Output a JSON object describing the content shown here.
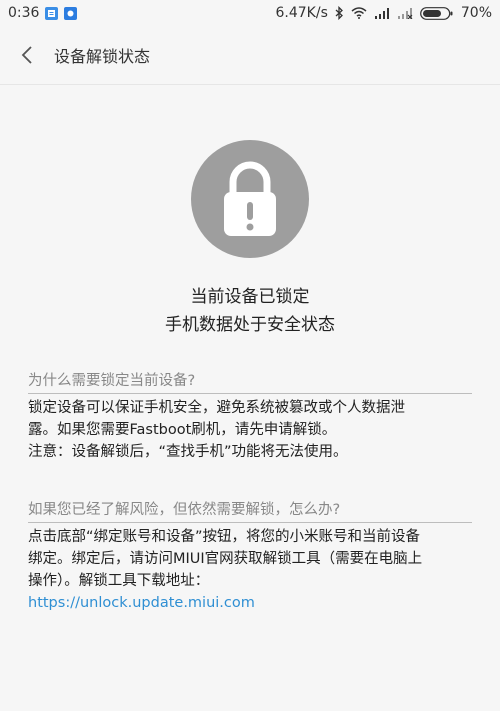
{
  "status_bar": {
    "time": "0:36",
    "speed": "6.47K/s",
    "battery": "70%"
  },
  "header": {
    "title": "设备解锁状态"
  },
  "status": {
    "line1": "当前设备已锁定",
    "line2": "手机数据处于安全状态"
  },
  "section1": {
    "title": "为什么需要锁定当前设备?",
    "line1": "锁定设备可以保证手机安全，避免系统被篡改或个人数据泄",
    "line2": "露。如果您需要Fastboot刷机，请先申请解锁。",
    "line3": "注意：设备解锁后，“查找手机”功能将无法使用。"
  },
  "section2": {
    "title": "如果您已经了解风险，但依然需要解锁，怎么办?",
    "line1": "点击底部“绑定账号和设备”按钮，将您的小米账号和当前设备",
    "line2": "绑定。绑定后，请访问MIUI官网获取解锁工具（需要在电脑上",
    "line3": "操作）。解锁工具下载地址：",
    "link": "https://unlock.update.miui.com"
  },
  "colors": {
    "accent": "#2f8fd3",
    "lock_bg": "#9e9e9e"
  }
}
